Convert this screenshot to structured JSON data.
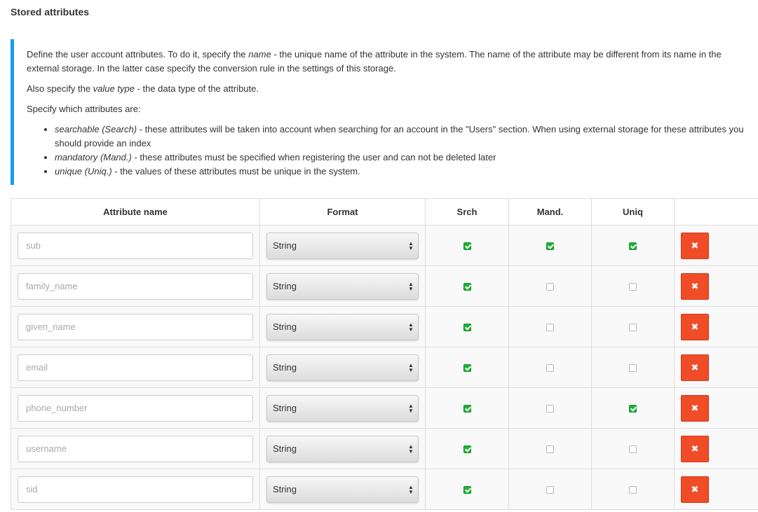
{
  "section": {
    "title": "Stored attributes"
  },
  "info": {
    "p1_a": "Define the user account attributes. To do it, specify the ",
    "p1_em": "name",
    "p1_b": " - the unique name of the attribute in the system. The name of the attribute may be different from its name in the external storage. In the latter case specify the conversion rule in the settings of this storage.",
    "p2_a": "Also specify the ",
    "p2_em": "value type",
    "p2_b": " - the data type of the attribute.",
    "p3": "Specify which attributes are:",
    "bullets": [
      {
        "em": "searchable (Search)",
        "text": " - these attributes will be taken into account when searching for an account in the \"Users\" section. When using external storage for these attributes you should provide an index"
      },
      {
        "em": "mandatory (Mand.)",
        "text": " - these attributes must be specified when registering the user and can not be deleted later"
      },
      {
        "em": "unique (Uniq.)",
        "text": " - the values of these attributes must be unique in the system."
      }
    ]
  },
  "table": {
    "headers": {
      "name": "Attribute name",
      "format": "Format",
      "search": "Srch",
      "mandatory": "Mand.",
      "unique": "Uniq",
      "actions": ""
    },
    "rows": [
      {
        "name_placeholder": "sub",
        "format": "String",
        "search": true,
        "mandatory": true,
        "unique": true
      },
      {
        "name_placeholder": "family_name",
        "format": "String",
        "search": true,
        "mandatory": false,
        "unique": false
      },
      {
        "name_placeholder": "given_name",
        "format": "String",
        "search": true,
        "mandatory": false,
        "unique": false
      },
      {
        "name_placeholder": "email",
        "format": "String",
        "search": true,
        "mandatory": false,
        "unique": false
      },
      {
        "name_placeholder": "phone_number",
        "format": "String",
        "search": true,
        "mandatory": false,
        "unique": true
      },
      {
        "name_placeholder": "username",
        "format": "String",
        "search": true,
        "mandatory": false,
        "unique": false
      },
      {
        "name_placeholder": "sid",
        "format": "String",
        "search": true,
        "mandatory": false,
        "unique": false
      }
    ],
    "delete_icon": "close-x-icon"
  },
  "colors": {
    "accent_bar": "#1e9be8",
    "checkbox_on": "#1fb136",
    "delete_button": "#f04c28"
  }
}
